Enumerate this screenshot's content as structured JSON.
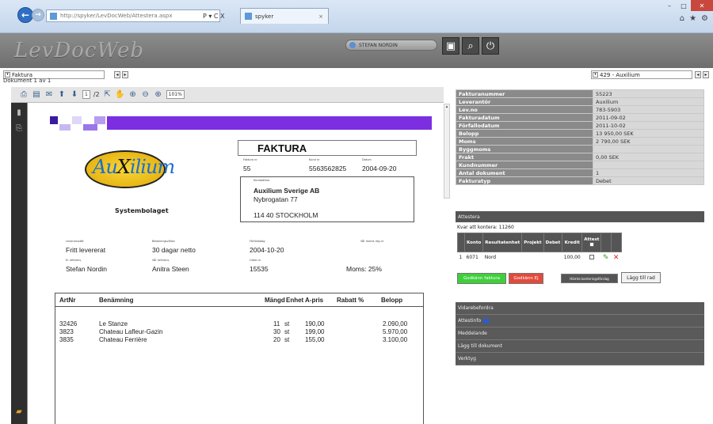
{
  "browser": {
    "url": "http://spyker/LevDocWeb/Attestera.aspx",
    "addr_tools": "P ▾ C X",
    "tab_label": "spyker",
    "tab_close": "×"
  },
  "app": {
    "logo": "LevDocWeb",
    "user": "STEFAN NORDIN"
  },
  "doc_selectors": {
    "type_value": "Faktura",
    "doc_count": "Dokument 1 av 1",
    "supplier_value": "429 - Auxilium"
  },
  "viewer": {
    "page_input": "1",
    "page_total": "/2",
    "zoom": "101%"
  },
  "invoice": {
    "title": "FAKTURA",
    "logo_a": "Au",
    "logo_x": "X",
    "logo_rest": "ilium",
    "company": "Systembolaget",
    "fields_top": [
      {
        "label": "Faktura nr",
        "value": "55"
      },
      {
        "label": "Kund nr",
        "value": "5563562825"
      },
      {
        "label": "Datum",
        "value": "2004-09-20"
      }
    ],
    "address_label": "Kundadress",
    "address": [
      "Auxilium Sverige AB",
      "Nybrogatan 77",
      "114 40 STOCKHOLM"
    ],
    "fields_mid": [
      {
        "label": "Leveranssätt",
        "value": "Fritt levererat"
      },
      {
        "label": "Betalningsvillkor",
        "value": "30 dagar netto"
      },
      {
        "label": "Förfallodag",
        "value": "2004-10-20"
      },
      {
        "label": "Vår moms reg.nr",
        "value": ""
      }
    ],
    "fields_low": [
      {
        "label": "Er referens",
        "value": "Stefan Nordin"
      },
      {
        "label": "Vår referens",
        "value": "Anitra Steen"
      },
      {
        "label": "Order nr",
        "value": "15535"
      },
      {
        "label": "",
        "value": "Moms: 25%"
      }
    ],
    "item_headers": [
      "ArtNr",
      "Benämning",
      "Mängd",
      "Enhet",
      "A-pris",
      "Rabatt %",
      "Belopp"
    ],
    "items": [
      {
        "artnr": "32426",
        "name": "Le Stanze",
        "qty": "11",
        "unit": "st",
        "price": "190,00",
        "amount": "2.090,00"
      },
      {
        "artnr": "3823",
        "name": "Chateau Lafleur-Gazin",
        "qty": "30",
        "unit": "st",
        "price": "199,00",
        "amount": "5.970,00"
      },
      {
        "artnr": "3835",
        "name": "Chateau Ferrière",
        "qty": "20",
        "unit": "st",
        "price": "155,00",
        "amount": "3.100,00"
      }
    ]
  },
  "meta": [
    {
      "key": "Fakturanummer",
      "value": "55223"
    },
    {
      "key": "Leverantör",
      "value": "Auxilium"
    },
    {
      "key": "Lev.no",
      "value": "783-5903"
    },
    {
      "key": "Fakturadatum",
      "value": "2011-09-02"
    },
    {
      "key": "Förfallodatum",
      "value": "2011-10-02"
    },
    {
      "key": "Belopp",
      "value": "13 950,00 SEK"
    },
    {
      "key": "Moms",
      "value": "2 790,00 SEK"
    },
    {
      "key": "Byggmoms",
      "value": ""
    },
    {
      "key": "Frakt",
      "value": "0,00 SEK"
    },
    {
      "key": "Kundnummer",
      "value": ""
    },
    {
      "key": "Antal dokument",
      "value": "1"
    },
    {
      "key": "Fakturatyp",
      "value": "Debet"
    }
  ],
  "attest": {
    "section_title": "Attestera",
    "kvar": "Kvar att kontera: 11260",
    "headers": [
      "Konto",
      "Resultatenhet",
      "Projekt",
      "Debet",
      "Kredit",
      "Attest"
    ],
    "row": {
      "num": "1",
      "konto": "6071",
      "resultatenhet": "Nord",
      "projekt": "",
      "debet": "",
      "kredit": "100,00"
    },
    "btn_approve": "Godkänn faktura",
    "btn_reject": "Godkänn Ej",
    "btn_fetch": "Hämta konteringsförslag",
    "btn_add_row": "Lägg till rad"
  },
  "accordion": [
    "Vidarebefordra",
    "Attestinfo",
    "Meddelande",
    "Lägg till dokument",
    "Verktyg"
  ]
}
